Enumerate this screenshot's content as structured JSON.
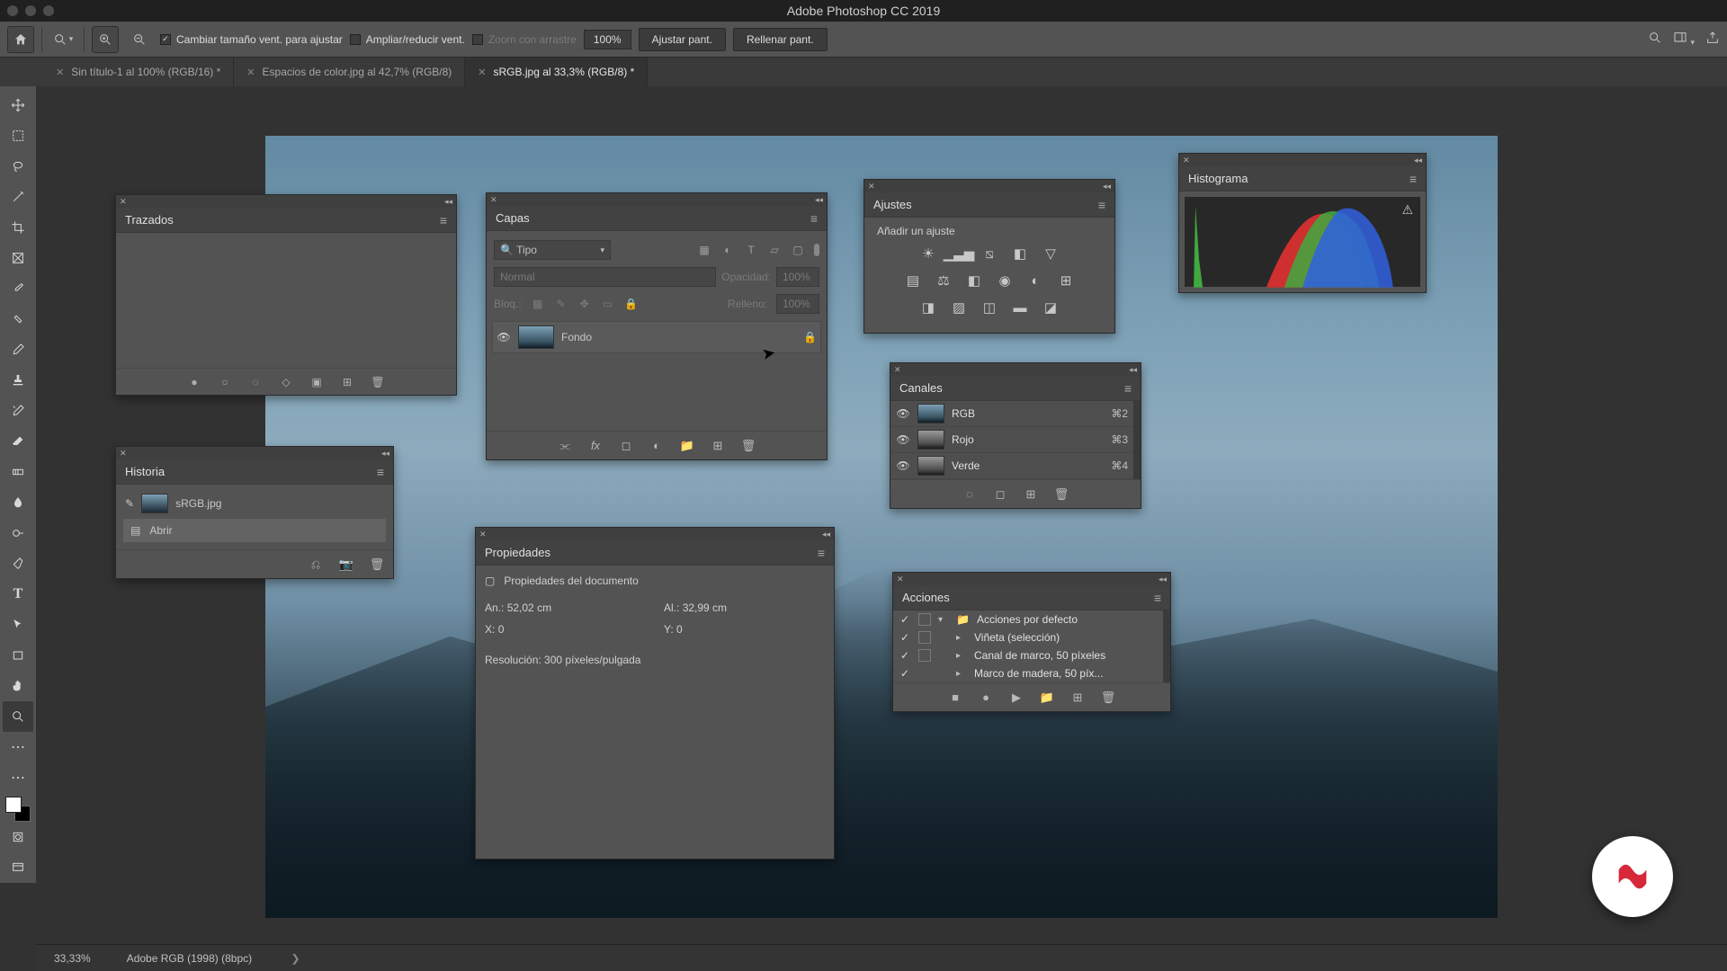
{
  "titlebar": {
    "title": "Adobe Photoshop CC 2019"
  },
  "optionbar": {
    "resize_window": "Cambiar tamaño vent. para ajustar",
    "zoom_all_windows": "Ampliar/reducir vent.",
    "scrubby_zoom": "Zoom con arrastre",
    "zoom_pct": "100%",
    "fit_screen": "Ajustar pant.",
    "fill_screen": "Rellenar pant."
  },
  "tabs": [
    {
      "label": "Sin título-1 al 100% (RGB/16) *",
      "active": false
    },
    {
      "label": "Espacios de color.jpg al 42,7% (RGB/8)",
      "active": false
    },
    {
      "label": "sRGB.jpg al 33,3% (RGB/8) *",
      "active": true
    }
  ],
  "panels": {
    "trazados": {
      "title": "Trazados"
    },
    "historia": {
      "title": "Historia",
      "source": "sRGB.jpg",
      "items": [
        "Abrir"
      ]
    },
    "capas": {
      "title": "Capas",
      "filter_label": "Tipo",
      "blend_mode": "Normal",
      "opacity_label": "Opacidad:",
      "opacity_value": "100%",
      "lock_label": "Bloq.:",
      "fill_label": "Relleno:",
      "fill_value": "100%",
      "layer_name": "Fondo"
    },
    "propiedades": {
      "title": "Propiedades",
      "heading": "Propiedades del documento",
      "width_label": "An.:",
      "width_value": "52,02 cm",
      "height_label": "Al.:",
      "height_value": "32,99 cm",
      "x_label": "X:",
      "x_value": "0",
      "y_label": "Y:",
      "y_value": "0",
      "resolution": "Resolución: 300 píxeles/pulgada"
    },
    "ajustes": {
      "title": "Ajustes",
      "heading": "Añadir un ajuste"
    },
    "canales": {
      "title": "Canales",
      "items": [
        {
          "name": "RGB",
          "key": "⌘2"
        },
        {
          "name": "Rojo",
          "key": "⌘3"
        },
        {
          "name": "Verde",
          "key": "⌘4"
        }
      ]
    },
    "histograma": {
      "title": "Histograma"
    },
    "acciones": {
      "title": "Acciones",
      "items": [
        {
          "name": "Acciones por defecto",
          "folder": true
        },
        {
          "name": "Viñeta (selección)",
          "folder": false
        },
        {
          "name": "Canal de marco, 50 píxeles",
          "folder": false
        },
        {
          "name": "Marco de madera, 50 píx...",
          "folder": false
        }
      ]
    }
  },
  "statusbar": {
    "zoom": "33,33%",
    "profile": "Adobe RGB (1998) (8bpc)"
  }
}
